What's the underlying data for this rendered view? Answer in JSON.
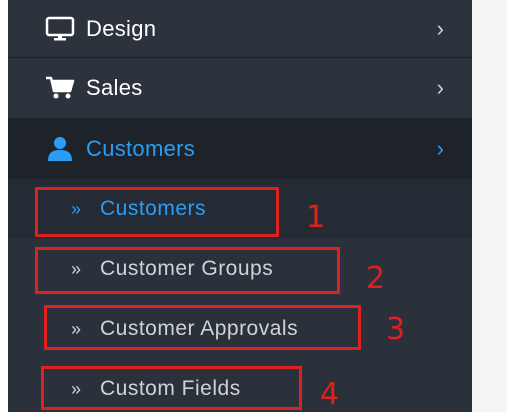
{
  "menu": {
    "design": {
      "label": "Design",
      "icon": "monitor-icon"
    },
    "sales": {
      "label": "Sales",
      "icon": "shopping-cart-icon"
    },
    "customers": {
      "label": "Customers",
      "icon": "user-icon"
    }
  },
  "submenu": {
    "items": [
      {
        "label": "Customers",
        "active": true,
        "annotation": "1"
      },
      {
        "label": "Customer Groups",
        "active": false,
        "annotation": "2"
      },
      {
        "label": "Customer Approvals",
        "active": false,
        "annotation": "3"
      },
      {
        "label": "Custom Fields",
        "active": false,
        "annotation": "4"
      }
    ],
    "arrow_glyph": "»"
  },
  "chevron_glyph": "›",
  "colors": {
    "sidebar_bg": "#252b35",
    "active_text": "#2a9df4",
    "annotation": "#e01f1f"
  }
}
